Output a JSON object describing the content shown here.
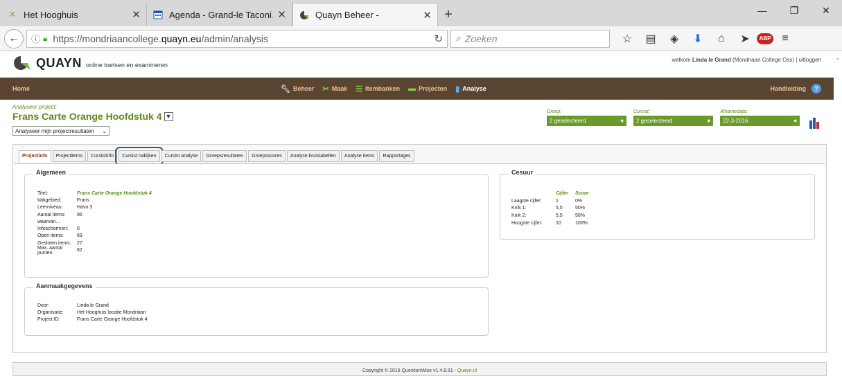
{
  "browser": {
    "tabs": [
      {
        "label": "Het Hooghuis",
        "icon": "x-logo-icon"
      },
      {
        "label": "Agenda - Grand-le Taconi…",
        "icon": "calendar-icon"
      },
      {
        "label": "Quayn Beheer -",
        "icon": "quayn-logo-icon"
      }
    ],
    "url_prefix": "https://mondriaancollege.",
    "url_domain": "quayn.eu",
    "url_path": "/admin/analysis",
    "search_placeholder": "Zoeken",
    "abp_label": "ABP"
  },
  "app": {
    "brand": "QUAYN",
    "tagline": "online toetsen en examineren",
    "welcome_prefix": "welkom ",
    "user_name": "Linda le Grand",
    "org": " (Mondriaan College Oss)",
    "separator": " | ",
    "logout": "uitloggen",
    "nav": {
      "home": "Home",
      "items": [
        "Beheer",
        "Maak",
        "Itembanken",
        "Projecten",
        "Analyse"
      ],
      "help": "Handleiding",
      "help_icon": "?"
    }
  },
  "project": {
    "label": "Analyseer project:",
    "title": "Frans Carte Orange Hoofdstuk 4",
    "mode": "Analyseer mijn projectresultaten",
    "filters": [
      {
        "label": "Groep:",
        "value": "2 geselecteerd"
      },
      {
        "label": "Cursist:",
        "value": "2 geselecteerd"
      },
      {
        "label": "Afnamedata:",
        "value": "22-3-2016"
      }
    ]
  },
  "tabs": [
    "Projectinfo",
    "Projectitems",
    "Cursistinfo",
    "Cursist nakijken",
    "Cursist analyse",
    "Groepsresultaten",
    "Groepsscores",
    "Analyse kruistabellen",
    "Analyse items",
    "Rapportages"
  ],
  "algemeen": {
    "heading": "Algemeen",
    "rows": [
      {
        "k": "Titel:",
        "v": "Frans Carte Orange Hoofdstuk 4"
      },
      {
        "k": "Vakgebied:",
        "v": "Frans"
      },
      {
        "k": "Leerniveau:",
        "v": "Havo 3"
      },
      {
        "k": "Aantal items:",
        "v": "96"
      },
      {
        "k": "waarvan...",
        "v": ""
      },
      {
        "k": "Infoschermen:",
        "v": "0"
      },
      {
        "k": "Open items:",
        "v": "69"
      },
      {
        "k": "Gesloten items:",
        "v": "27"
      },
      {
        "k": "Max. aantal punten:",
        "v": "82"
      }
    ]
  },
  "cesuur": {
    "heading": "Cesuur",
    "headers": [
      "",
      "Cijfer",
      "Score"
    ],
    "rows": [
      [
        "Laagste cijfer:",
        "1",
        "0%"
      ],
      [
        "Knik 1:",
        "5,5",
        "50%"
      ],
      [
        "Knik 2:",
        "5,5",
        "50%"
      ],
      [
        "Hoogste cijfer:",
        "10",
        "100%"
      ]
    ]
  },
  "aanmaak": {
    "heading": "Aanmaakgegevens",
    "rows": [
      {
        "k": "Door:",
        "v": "Linda le Grand"
      },
      {
        "k": "Organisatie:",
        "v": "Het Hooghuis locatie Mondriaan"
      },
      {
        "k": "Project ID:",
        "v": "Frans Carte Orange Hoofdstuk 4"
      }
    ]
  },
  "footer": {
    "text": "Copyright © 2016 QuestionWise v1.4.8.81 - ",
    "link": "Quayn.nl"
  },
  "colors": {
    "accent_green": "#5e8a1a",
    "nav_brown": "#5a4533",
    "highlight": "#2f5a90"
  }
}
